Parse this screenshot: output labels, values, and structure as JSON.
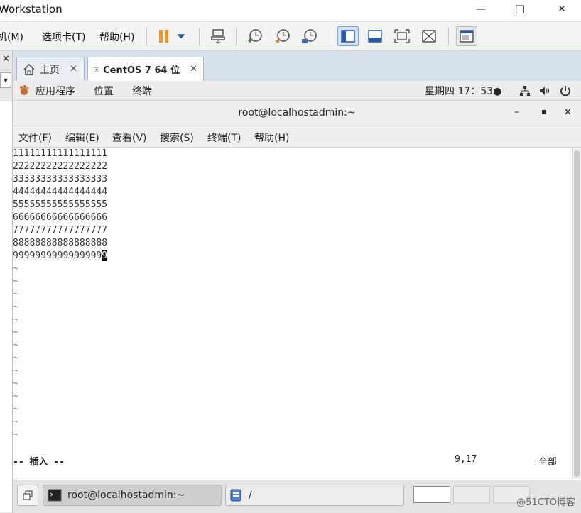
{
  "window": {
    "title": "Workstation",
    "min": "—",
    "max": "☐",
    "close": "✕"
  },
  "menubar": {
    "items": [
      "机(M)",
      "选项卡(T)",
      "帮助(H)"
    ],
    "left_glyph": "✕",
    "dropdown_glyph": "▾"
  },
  "tabs": [
    {
      "label": "主页",
      "close": "✕"
    },
    {
      "label": "CentOS 7 64 位",
      "close": "✕"
    }
  ],
  "gnome_bar": {
    "apps": "应用程序",
    "places": "位置",
    "terminal": "终端",
    "clock": "星期四 17：53●"
  },
  "terminal": {
    "title": "root@localhostadmin:~",
    "controls": {
      "min": "–",
      "max": "▪",
      "close": "✕"
    },
    "menu": [
      "文件(F)",
      "编辑(E)",
      "查看(V)",
      "搜索(S)",
      "终端(T)",
      "帮助(H)"
    ],
    "lines": [
      "11111111111111111",
      "22222222222222222",
      "33333333333333333",
      "44444444444444444",
      "55555555555555555",
      "66666666666666666",
      "77777777777777777",
      "88888888888888888",
      "9999999999999999"
    ],
    "cursor_char": "9",
    "tilde_lines": [
      "~",
      "~",
      "~",
      "~",
      "~",
      "~",
      "~",
      "~",
      "~",
      "~",
      "~",
      "~",
      "~",
      "~"
    ],
    "status_mode": "-- 插入 --",
    "status_pos": "9,17",
    "status_all": "全部"
  },
  "taskbar": {
    "task1": "root@localhostadmin:~",
    "task2": "/",
    "watermark": "@51CTO博客"
  }
}
